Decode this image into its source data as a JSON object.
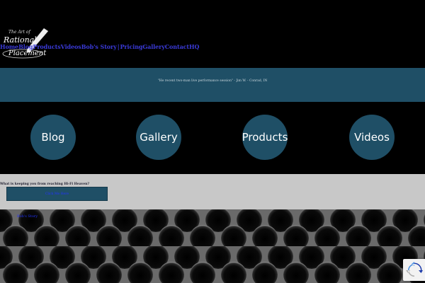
{
  "logo": {
    "line1": "The Art of",
    "line2": "Rational",
    "line3": "Placement"
  },
  "nav": {
    "items": [
      "Home",
      "Blog",
      "Products",
      "Videos",
      "Bob's Story",
      "Pricing",
      "Gallery",
      "Contact",
      "HQ"
    ]
  },
  "quote": {
    "text": "\"He recent two-man live performance session\" - Jim W. - Conrad, IN"
  },
  "tiles": [
    {
      "label": "Blog"
    },
    {
      "label": "Gallery"
    },
    {
      "label": "Products"
    },
    {
      "label": "Videos"
    }
  ],
  "promo": {
    "question": "What is keeping you from reaching Hi-Fi Heaven?",
    "button_label": "Click Me Here"
  },
  "footer": {
    "links": [
      "",
      "Bob's Story",
      "",
      "",
      "",
      "",
      ""
    ]
  },
  "colors": {
    "accent": "#1f4f66",
    "nav_link": "#3a3ad8",
    "band_gray": "#c8c8c8"
  }
}
